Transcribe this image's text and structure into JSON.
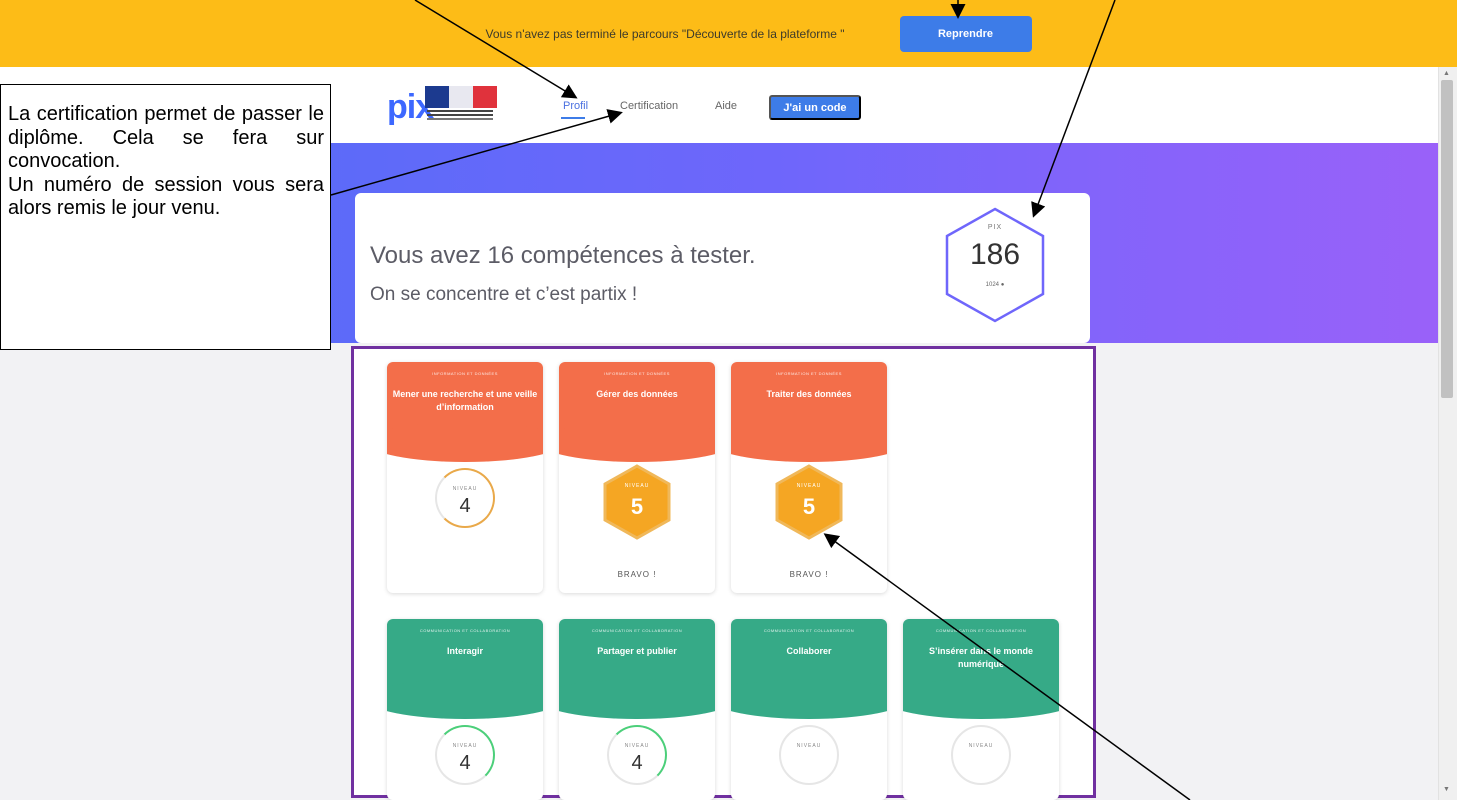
{
  "banner": {
    "message": "Vous n'avez pas terminé le parcours \"Découverte de la plateforme \"",
    "button_label": "Reprendre",
    "background": "#fdbc17"
  },
  "nav": {
    "logo_text": "pix",
    "links": [
      "Profil",
      "Certification",
      "Aide"
    ],
    "code_button": "J'ai un code",
    "accent": "#3d7ce8"
  },
  "hero": {
    "line1": "Vous avez 16 compétences à tester.",
    "line2": "On se concentre et c’est partix !",
    "score_label": "PIX",
    "score_value": "186",
    "score_max": "1024"
  },
  "competences": [
    {
      "category": "INFORMATION ET DONNÉES",
      "name": "Mener une recherche et une veille d’information",
      "level_label": "NIVEAU",
      "level": "4",
      "style": "ring",
      "color": "#f36e4a"
    },
    {
      "category": "INFORMATION ET DONNÉES",
      "name": "Gérer des données",
      "level_label": "NIVEAU",
      "level": "5",
      "style": "hex",
      "status": "BRAVO !",
      "color": "#f36e4a"
    },
    {
      "category": "INFORMATION ET DONNÉES",
      "name": "Traiter des données",
      "level_label": "NIVEAU",
      "level": "5",
      "style": "hex",
      "status": "BRAVO !",
      "color": "#f36e4a"
    },
    {
      "category": "COMMUNICATION ET COLLABORATION",
      "name": "Interagir",
      "level_label": "NIVEAU",
      "level": "4",
      "style": "ring",
      "color": "#36aa87"
    },
    {
      "category": "COMMUNICATION ET COLLABORATION",
      "name": "Partager et publier",
      "level_label": "NIVEAU",
      "level": "4",
      "style": "ring",
      "color": "#36aa87"
    },
    {
      "category": "COMMUNICATION ET COLLABORATION",
      "name": "Collaborer",
      "level_label": "NIVEAU",
      "level": "",
      "style": "ring",
      "color": "#36aa87"
    },
    {
      "category": "COMMUNICATION ET COLLABORATION",
      "name": "S’insérer dans le monde numérique",
      "level_label": "NIVEAU",
      "level": "",
      "style": "ring",
      "color": "#36aa87"
    }
  ],
  "callout": {
    "p1": "La certification permet de passer le diplôme. Cela se fera sur convocation.",
    "p2": "Un numéro de session vous sera alors remis le jour venu."
  }
}
